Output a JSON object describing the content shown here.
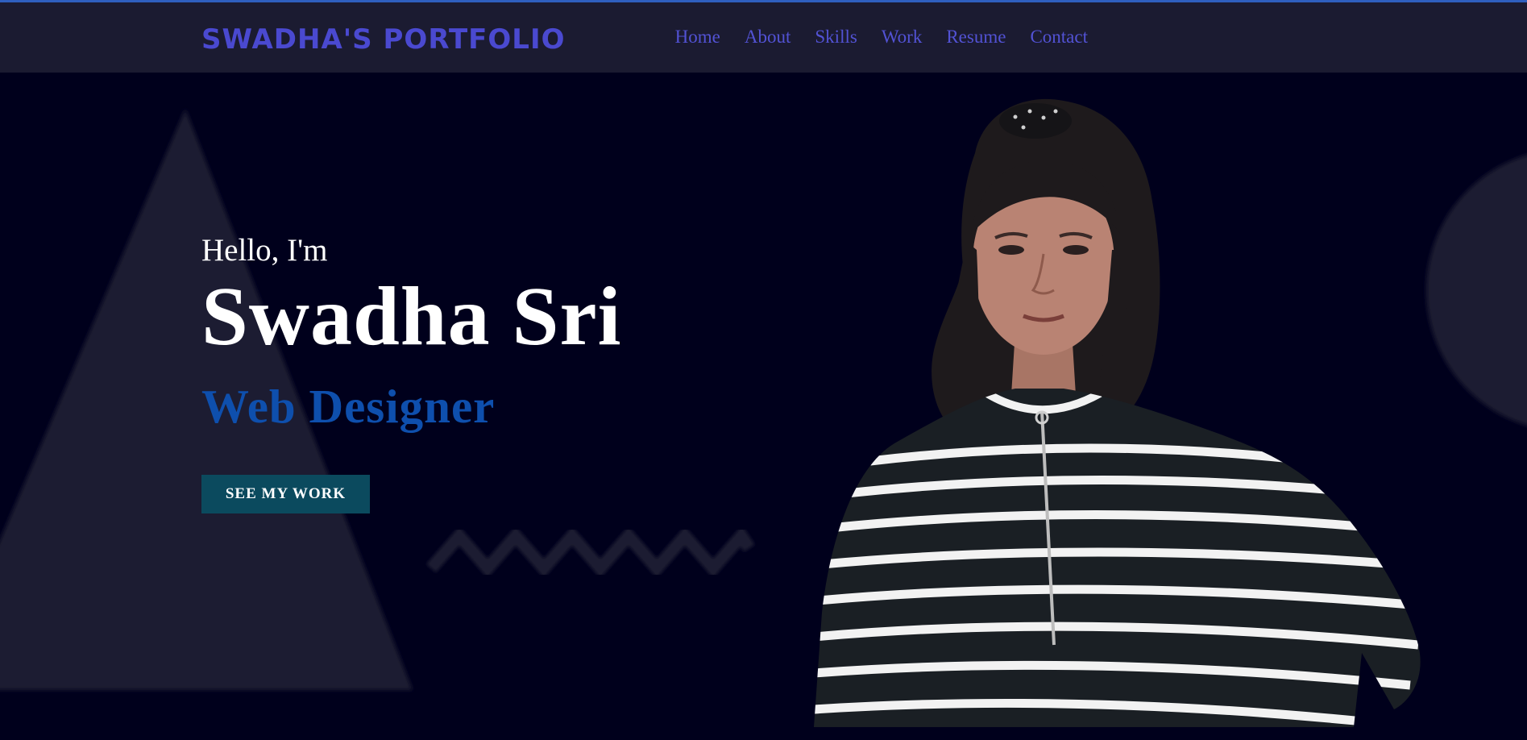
{
  "header": {
    "logo": "SWADHA'S PORTFOLIO",
    "nav": [
      "Home",
      "About",
      "Skills",
      "Work",
      "Resume",
      "Contact"
    ]
  },
  "hero": {
    "greeting": "Hello, I'm",
    "name": "Swadha Sri",
    "role": "Web Designer",
    "cta": "SEE MY WORK",
    "portrait_icon": "portrait-photo"
  },
  "colors": {
    "background": "#00001c",
    "navbar": "#1b1b31",
    "accent": "#4a49d0",
    "role": "#0e4fad",
    "button": "#0b4a5e"
  }
}
